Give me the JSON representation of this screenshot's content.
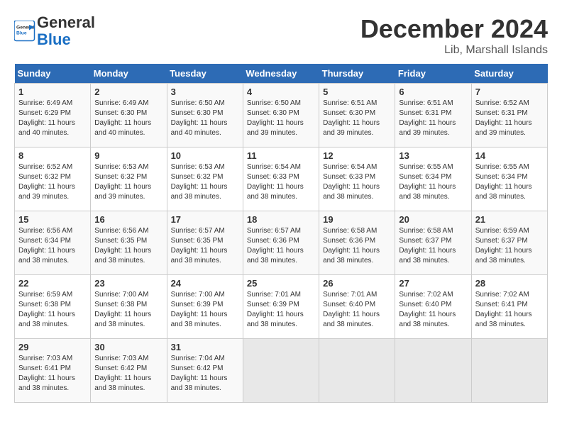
{
  "header": {
    "logo_general": "General",
    "logo_blue": "Blue",
    "month_title": "December 2024",
    "location": "Lib, Marshall Islands"
  },
  "days_of_week": [
    "Sunday",
    "Monday",
    "Tuesday",
    "Wednesday",
    "Thursday",
    "Friday",
    "Saturday"
  ],
  "weeks": [
    [
      {
        "day": "1",
        "sunrise": "6:49 AM",
        "sunset": "6:29 PM",
        "daylight": "11 hours and 40 minutes."
      },
      {
        "day": "2",
        "sunrise": "6:49 AM",
        "sunset": "6:30 PM",
        "daylight": "11 hours and 40 minutes."
      },
      {
        "day": "3",
        "sunrise": "6:50 AM",
        "sunset": "6:30 PM",
        "daylight": "11 hours and 40 minutes."
      },
      {
        "day": "4",
        "sunrise": "6:50 AM",
        "sunset": "6:30 PM",
        "daylight": "11 hours and 39 minutes."
      },
      {
        "day": "5",
        "sunrise": "6:51 AM",
        "sunset": "6:30 PM",
        "daylight": "11 hours and 39 minutes."
      },
      {
        "day": "6",
        "sunrise": "6:51 AM",
        "sunset": "6:31 PM",
        "daylight": "11 hours and 39 minutes."
      },
      {
        "day": "7",
        "sunrise": "6:52 AM",
        "sunset": "6:31 PM",
        "daylight": "11 hours and 39 minutes."
      }
    ],
    [
      {
        "day": "8",
        "sunrise": "6:52 AM",
        "sunset": "6:32 PM",
        "daylight": "11 hours and 39 minutes."
      },
      {
        "day": "9",
        "sunrise": "6:53 AM",
        "sunset": "6:32 PM",
        "daylight": "11 hours and 39 minutes."
      },
      {
        "day": "10",
        "sunrise": "6:53 AM",
        "sunset": "6:32 PM",
        "daylight": "11 hours and 38 minutes."
      },
      {
        "day": "11",
        "sunrise": "6:54 AM",
        "sunset": "6:33 PM",
        "daylight": "11 hours and 38 minutes."
      },
      {
        "day": "12",
        "sunrise": "6:54 AM",
        "sunset": "6:33 PM",
        "daylight": "11 hours and 38 minutes."
      },
      {
        "day": "13",
        "sunrise": "6:55 AM",
        "sunset": "6:34 PM",
        "daylight": "11 hours and 38 minutes."
      },
      {
        "day": "14",
        "sunrise": "6:55 AM",
        "sunset": "6:34 PM",
        "daylight": "11 hours and 38 minutes."
      }
    ],
    [
      {
        "day": "15",
        "sunrise": "6:56 AM",
        "sunset": "6:34 PM",
        "daylight": "11 hours and 38 minutes."
      },
      {
        "day": "16",
        "sunrise": "6:56 AM",
        "sunset": "6:35 PM",
        "daylight": "11 hours and 38 minutes."
      },
      {
        "day": "17",
        "sunrise": "6:57 AM",
        "sunset": "6:35 PM",
        "daylight": "11 hours and 38 minutes."
      },
      {
        "day": "18",
        "sunrise": "6:57 AM",
        "sunset": "6:36 PM",
        "daylight": "11 hours and 38 minutes."
      },
      {
        "day": "19",
        "sunrise": "6:58 AM",
        "sunset": "6:36 PM",
        "daylight": "11 hours and 38 minutes."
      },
      {
        "day": "20",
        "sunrise": "6:58 AM",
        "sunset": "6:37 PM",
        "daylight": "11 hours and 38 minutes."
      },
      {
        "day": "21",
        "sunrise": "6:59 AM",
        "sunset": "6:37 PM",
        "daylight": "11 hours and 38 minutes."
      }
    ],
    [
      {
        "day": "22",
        "sunrise": "6:59 AM",
        "sunset": "6:38 PM",
        "daylight": "11 hours and 38 minutes."
      },
      {
        "day": "23",
        "sunrise": "7:00 AM",
        "sunset": "6:38 PM",
        "daylight": "11 hours and 38 minutes."
      },
      {
        "day": "24",
        "sunrise": "7:00 AM",
        "sunset": "6:39 PM",
        "daylight": "11 hours and 38 minutes."
      },
      {
        "day": "25",
        "sunrise": "7:01 AM",
        "sunset": "6:39 PM",
        "daylight": "11 hours and 38 minutes."
      },
      {
        "day": "26",
        "sunrise": "7:01 AM",
        "sunset": "6:40 PM",
        "daylight": "11 hours and 38 minutes."
      },
      {
        "day": "27",
        "sunrise": "7:02 AM",
        "sunset": "6:40 PM",
        "daylight": "11 hours and 38 minutes."
      },
      {
        "day": "28",
        "sunrise": "7:02 AM",
        "sunset": "6:41 PM",
        "daylight": "11 hours and 38 minutes."
      }
    ],
    [
      {
        "day": "29",
        "sunrise": "7:03 AM",
        "sunset": "6:41 PM",
        "daylight": "11 hours and 38 minutes."
      },
      {
        "day": "30",
        "sunrise": "7:03 AM",
        "sunset": "6:42 PM",
        "daylight": "11 hours and 38 minutes."
      },
      {
        "day": "31",
        "sunrise": "7:04 AM",
        "sunset": "6:42 PM",
        "daylight": "11 hours and 38 minutes."
      },
      null,
      null,
      null,
      null
    ]
  ]
}
